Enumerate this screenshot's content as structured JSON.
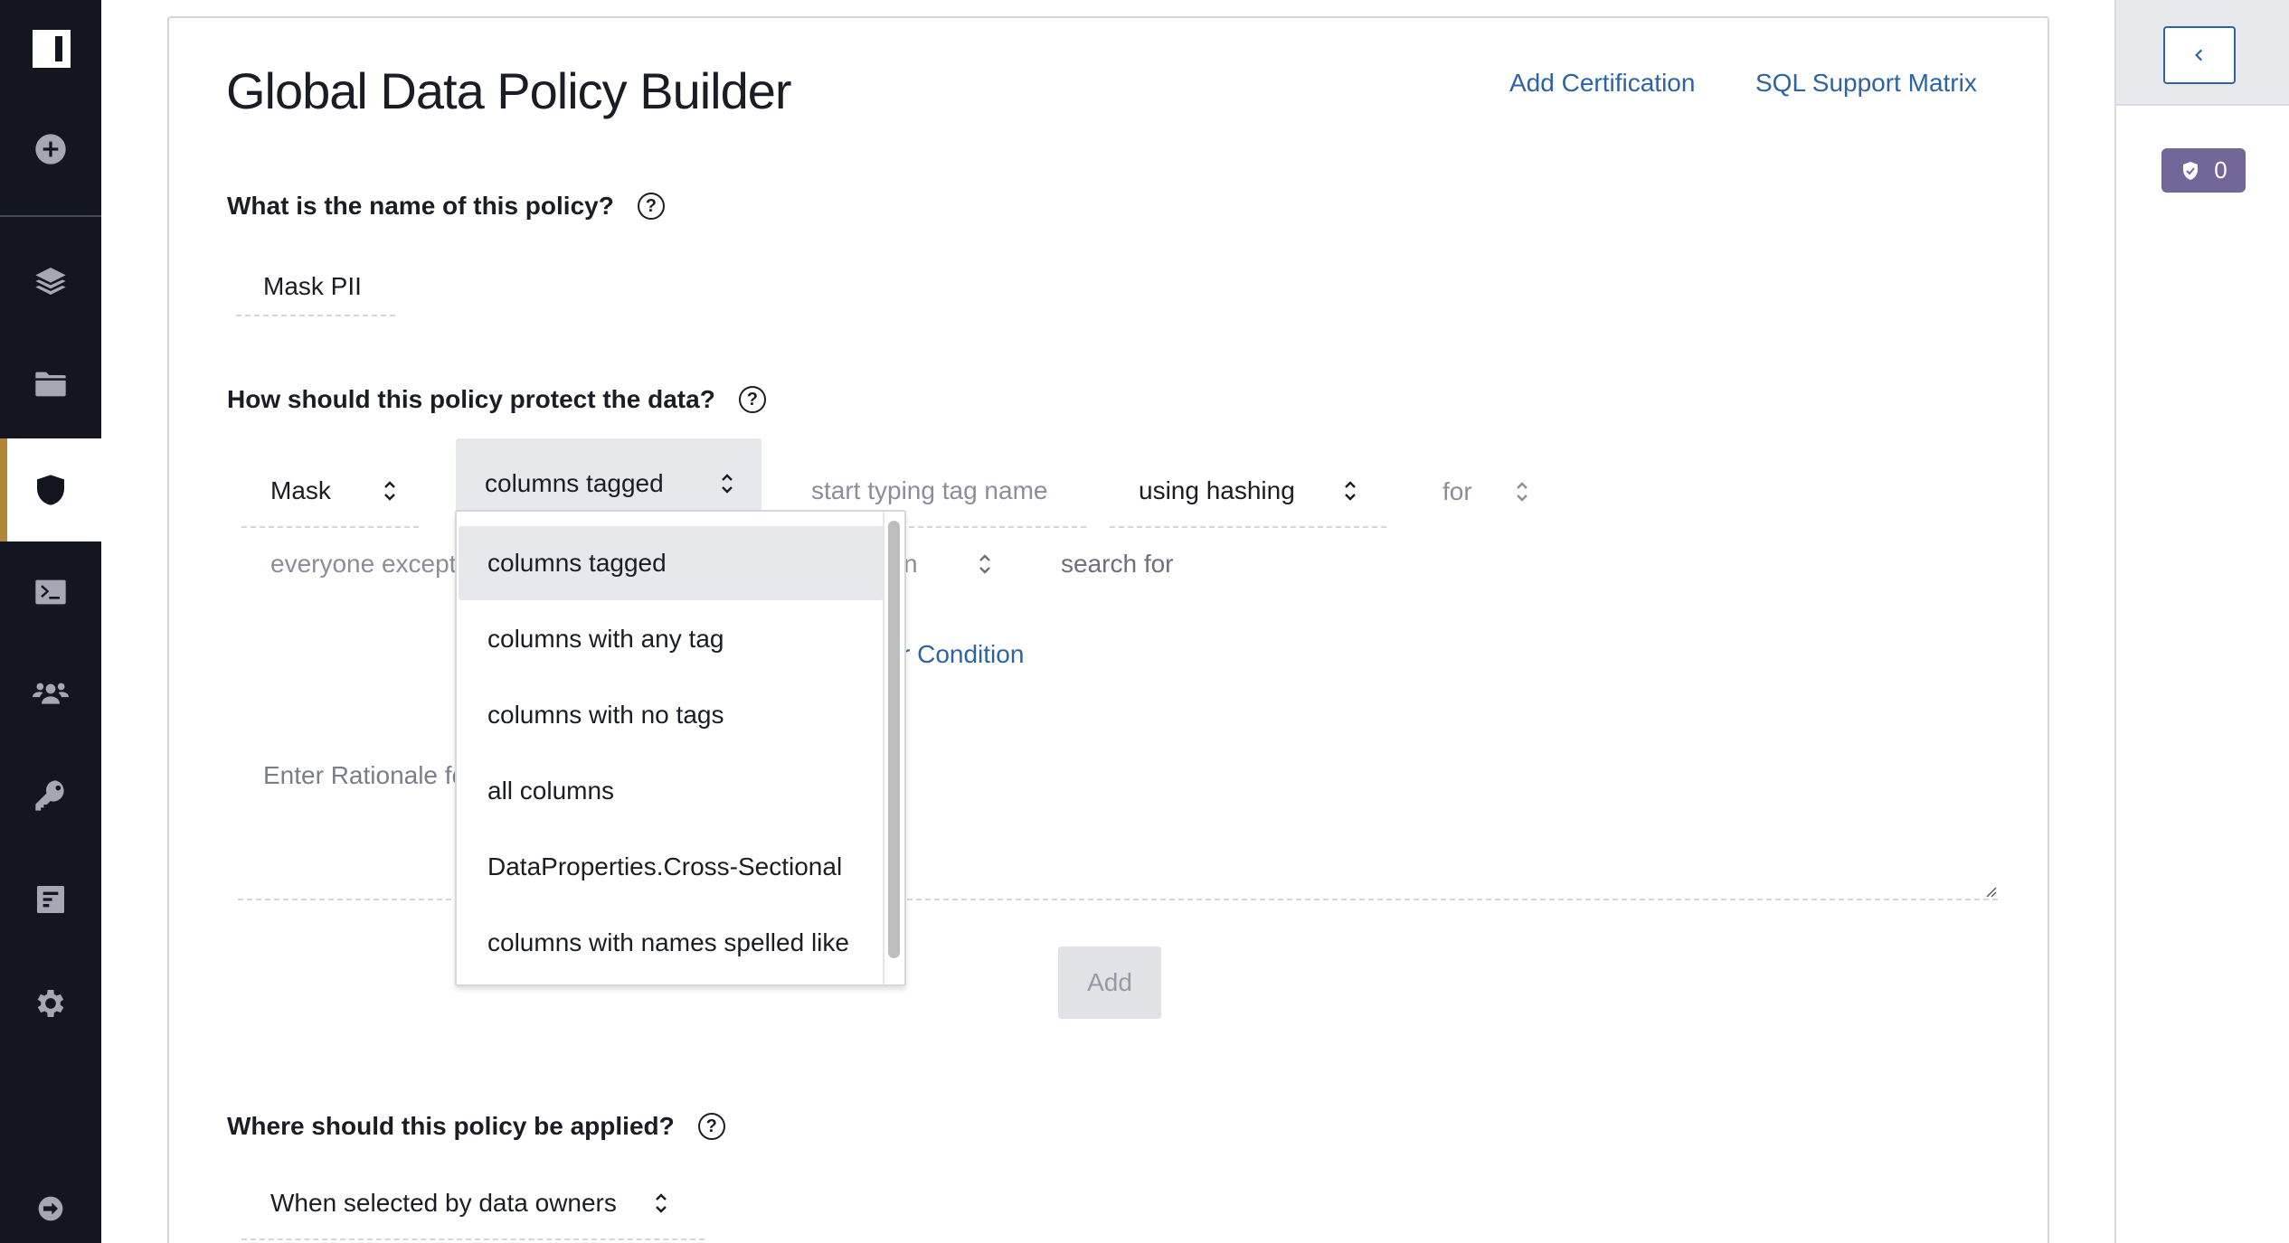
{
  "sidebar": {
    "logo": "I",
    "items": [
      {
        "name": "create",
        "icon": "plus-circle-icon"
      },
      {
        "name": "data-sources",
        "icon": "layers-icon"
      },
      {
        "name": "projects",
        "icon": "folder-icon"
      },
      {
        "name": "policies",
        "icon": "shield-icon",
        "active": true
      },
      {
        "name": "query-editor",
        "icon": "terminal-icon"
      },
      {
        "name": "people",
        "icon": "users-icon"
      },
      {
        "name": "access",
        "icon": "key-icon"
      },
      {
        "name": "audit",
        "icon": "document-icon"
      },
      {
        "name": "settings",
        "icon": "gear-icon"
      }
    ],
    "collapse_icon": "arrow-right-circle-icon"
  },
  "page": {
    "title": "Global Data Policy Builder",
    "links": {
      "add_certification": "Add Certification",
      "sql_support_matrix": "SQL Support Matrix"
    }
  },
  "policy_name": {
    "question": "What is the name of this policy?",
    "value": "Mask PII"
  },
  "protection": {
    "question": "How should this policy protect the data?",
    "action_select": "Mask",
    "target_select": "columns tagged",
    "tag_input_placeholder": "start typing tag name",
    "method_select": "using hashing",
    "for_select": "for",
    "condition_select": "everyone except",
    "condition_partial_select": "n",
    "search_for_label": "search for",
    "add_condition_link": "r Condition",
    "rationale_placeholder": "Enter Rationale for",
    "add_button": "Add"
  },
  "target_dropdown": {
    "options": [
      {
        "label": "columns tagged",
        "selected": true
      },
      {
        "label": "columns with any tag",
        "selected": false
      },
      {
        "label": "columns with no tags",
        "selected": false
      },
      {
        "label": "all columns",
        "selected": false
      },
      {
        "label": "DataProperties.Cross-Sectional",
        "selected": false
      },
      {
        "label": "columns with names spelled like",
        "selected": false
      }
    ]
  },
  "application": {
    "question": "Where should this policy be applied?",
    "select": "When selected by data owners"
  },
  "right_panel": {
    "collapse_button_icon": "chevron-left-icon",
    "badge_count": "0",
    "badge_icon": "shield-check-icon"
  },
  "colors": {
    "sidebar_bg": "#13161e",
    "active_accent": "#b08537",
    "link": "#2c64a3",
    "badge": "#736699"
  }
}
